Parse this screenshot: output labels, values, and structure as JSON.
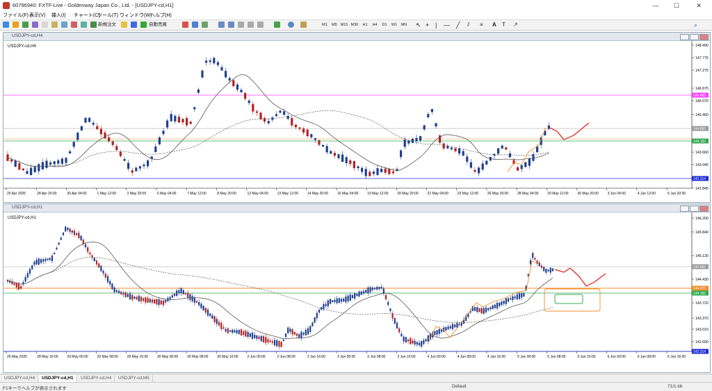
{
  "window": {
    "title": "60796940: FXTF-Live - Goldenway Japan Co., Ltd. - [USDJPY-cd,H1]",
    "minimize": "—",
    "maximize": "☐",
    "close": "✕"
  },
  "menu": [
    "ファイル(F)",
    "表示(V)",
    "挿入(I)",
    "チャート(C)",
    "ツール(T)",
    "ウィンドウ(W)",
    "ヘルプ(H)"
  ],
  "toolbar": {
    "new_order": "新規注文",
    "auto_trade": "自動売買",
    "timeframes": [
      "M1",
      "M5",
      "M15",
      "M30",
      "H1",
      "H4",
      "D1",
      "W1",
      "MN"
    ]
  },
  "chart_h4": {
    "window_title": "USDJPY-cd,H4",
    "symbol_label": "USDJPY-cd,H4",
    "price_ticks": [
      "148.490",
      "147.775",
      "147.275",
      "146.675",
      "146.075",
      "145.460",
      "144.860",
      "144.182",
      "143.660",
      "143.045",
      "142.314",
      "141.845"
    ],
    "time_ticks": [
      "25 Apr 2025",
      "28 Apr 20:00",
      "30 Apr 04:00",
      "1 May 12:00",
      "2 May 20:00",
      "6 May 04:00",
      "7 May 12:00",
      "8 May 20:00",
      "12 May 04:00",
      "13 May 12:00",
      "14 May 20:00",
      "16 May 04:00",
      "19 May 12:00",
      "20 May 20:00",
      "22 May 04:00",
      "23 May 12:00",
      "26 May 20:00",
      "28 May 04:00",
      "29 May 12:00",
      "30 May 20:00",
      "3 Jun 04:00",
      "4 Jun 12:00",
      "5 Jun 20:00"
    ],
    "hline_labels": {
      "magenta": "146.450",
      "current": "144.860",
      "green": "144.182",
      "blue": "142.314"
    }
  },
  "chart_h1": {
    "window_title": "USDJPY-cd,H1",
    "symbol_label": "USDJPY-cd,H1",
    "price_ticks": [
      "146.200",
      "145.840",
      "145.130",
      "144.860",
      "144.430",
      "144.070",
      "143.720",
      "143.370",
      "143.010",
      "142.600",
      "142.314"
    ],
    "time_ticks": [
      "26 May 2025",
      "28 May 16:00",
      "29 May 00:00",
      "29 May 08:00",
      "29 May 16:00",
      "30 May 00:00",
      "30 May 08:00",
      "30 May 16:00",
      "2 Jun 00:00",
      "2 Jun 08:00",
      "2 Jun 16:00",
      "3 Jun 00:00",
      "3 Jun 08:00",
      "3 Jun 16:00",
      "4 Jun 00:00",
      "4 Jun 08:00",
      "4 Jun 16:00",
      "5 Jun 00:00",
      "5 Jun 08:00",
      "5 Jun 16:00",
      "6 Jun 00:00",
      "6 Jun 08:00",
      "6 Jun 16:00"
    ],
    "hline_labels": {
      "orange": "144.270",
      "current": "144.860",
      "green": "144.182",
      "blue": "142.314"
    }
  },
  "tabs": [
    "USDJPY-cd,H4",
    "USDJPY-cd,H1",
    "USDJPY-cd,H4",
    "USDJPY-cd,M5"
  ],
  "status": {
    "help": "F1キーでヘルプが表示されます",
    "profile": "Default",
    "traffic": "71/1 kb"
  },
  "colors": {
    "bull": "#1f3f8f",
    "bear": "#b22222",
    "ma": "#555555",
    "magenta": "#ff3cff",
    "green": "#2fa84f",
    "orange": "#f28c28",
    "blue": "#1c2bd6",
    "forecast": "#e01b1b"
  }
}
